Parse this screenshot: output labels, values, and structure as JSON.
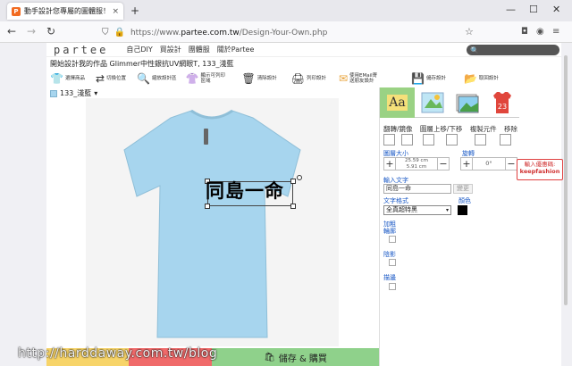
{
  "browser": {
    "tab_title": "動手設計您專屬的圖體服！Partee",
    "tab_favicon": "P",
    "tab_close": "×",
    "new_tab": "+",
    "win_minimize": "—",
    "win_maximize": "☐",
    "win_close": "✕",
    "back": "←",
    "forward": "→",
    "reload": "↻",
    "url_prefix": "https://www.",
    "url_domain": "partee.com.tw",
    "url_path": "/Design-Your-Own.php",
    "star": "☆"
  },
  "site": {
    "logo": "partee",
    "nav": [
      "自己DIY",
      "買設計",
      "團體服",
      "關於Partee"
    ],
    "search_icon": "search-icon"
  },
  "product_title": "開始設計我的作品 Glimmer中性銀抗UV網眼T, 133_淺藍",
  "toolbar": [
    {
      "icon": "👕",
      "label": "選擇商品"
    },
    {
      "icon": "⇄",
      "label": "切換位置"
    },
    {
      "icon": "🔍",
      "label": "縮放設計區"
    },
    {
      "icon": "👚",
      "label": "顯示可列印區域"
    },
    {
      "icon": "🗑",
      "label": "清除設計"
    },
    {
      "icon": "🖨",
      "label": "列印設計"
    },
    {
      "icon": "✉",
      "label": "使用EMail寄送朋友設計"
    }
  ],
  "toolbar_right": [
    {
      "icon": "💾",
      "label": "儲存設計"
    },
    {
      "icon": "📂",
      "label": "取回設計"
    }
  ],
  "color_select": {
    "label": "133_淺藍",
    "arrow": "▾",
    "swatch": "#a7d5ee"
  },
  "design": {
    "text": "同島一命",
    "shirt_color": "#a7d5ee"
  },
  "bottom": {
    "cart_icon": "🛍",
    "save_buy": "儲存 & 購買",
    "colors": [
      "#f7d469",
      "#f06a6a",
      "#8fd18b"
    ]
  },
  "panel": {
    "tabs": [
      {
        "icon": "Aa"
      },
      {
        "icon": "image-icon"
      },
      {
        "icon": "photo-icon"
      },
      {
        "icon": "23"
      }
    ],
    "ops_labels": [
      "翻轉/鏡像",
      "圖層上移/下移",
      "複製元件",
      "移除"
    ],
    "size_label": "圖層大小",
    "size_value_w": "25.59 cm",
    "size_value_h": "5.91 cm",
    "rotate_label": "旋轉",
    "rotate_value": "0°",
    "minus": "−",
    "plus": "+",
    "text_label": "輸入文字",
    "text_value": "同島一命",
    "change_btn": "變更",
    "font_label": "文字格式",
    "font_value": "全真超特黑",
    "color_label": "顏色",
    "bold_label": "加粗輪廓",
    "shadow_label": "陰影",
    "outline_label": "描邊"
  },
  "coupon": {
    "line1": "輸入優惠碼:",
    "line2": "keepfashion"
  },
  "watermark": "http://harddaway.com.tw/blog"
}
